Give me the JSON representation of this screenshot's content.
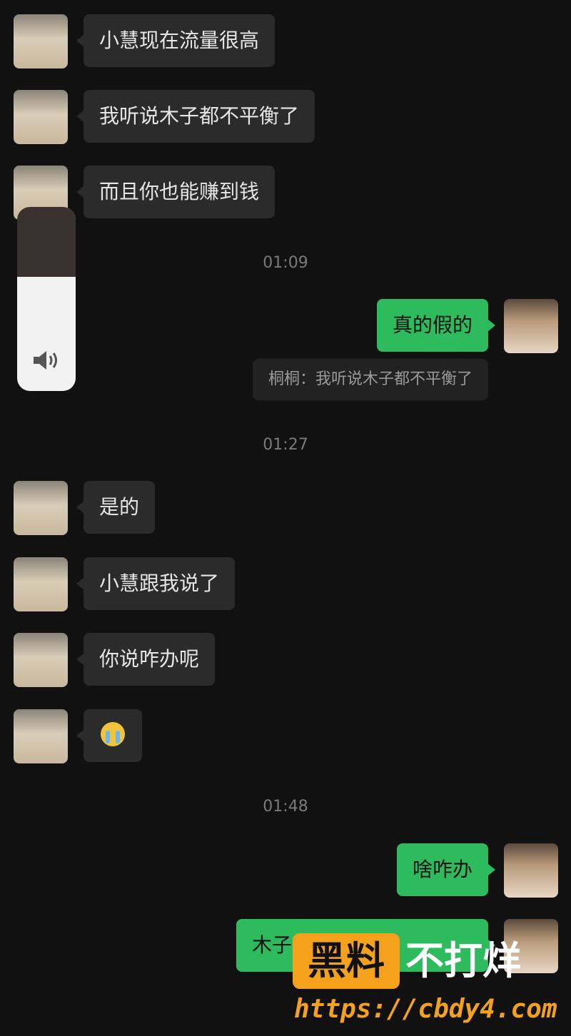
{
  "messages": [
    {
      "side": "in",
      "text": "小慧现在流量很高"
    },
    {
      "side": "in",
      "text": "我听说木子都不平衡了"
    },
    {
      "side": "in",
      "text": "而且你也能赚到钱"
    },
    {
      "time": "01:09"
    },
    {
      "side": "out",
      "text": "真的假的"
    },
    {
      "quote": "桐桐：我听说木子都不平衡了"
    },
    {
      "time": "01:27"
    },
    {
      "side": "in",
      "text": "是的"
    },
    {
      "side": "in",
      "text": "小慧跟我说了"
    },
    {
      "side": "in",
      "text": "你说咋办呢"
    },
    {
      "side": "in",
      "emoji": "crying-face"
    },
    {
      "time": "01:48"
    },
    {
      "side": "out",
      "text": "啥咋办"
    },
    {
      "side": "out",
      "text": "木子"
    }
  ],
  "volume_overlay": {
    "level_fraction": 0.62,
    "icon": "speaker-icon"
  },
  "watermark": {
    "box": "黑料",
    "text": "不打烊",
    "url": "https://cbdy4.com"
  },
  "colors": {
    "background": "#111111",
    "incoming": "#2b2b2b",
    "outgoing": "#2dbb5d",
    "watermark": "#f4a21c"
  }
}
